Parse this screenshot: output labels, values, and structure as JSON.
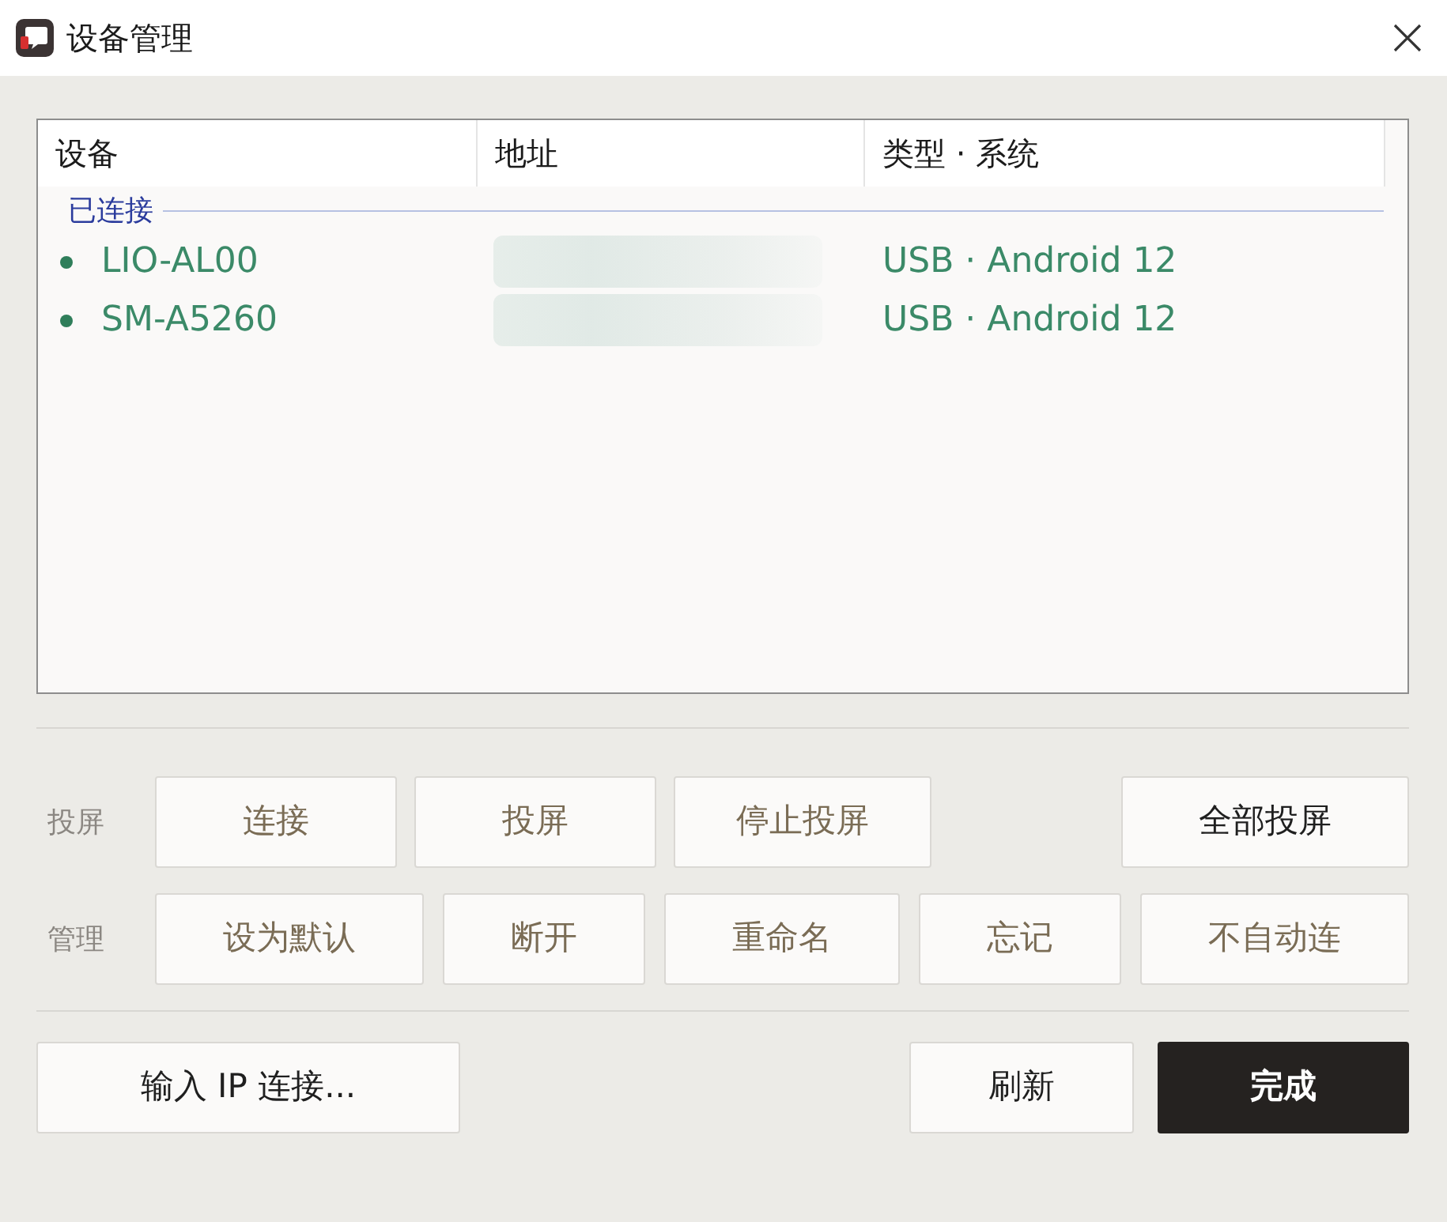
{
  "window": {
    "title": "设备管理"
  },
  "table": {
    "columns": [
      "设备",
      "地址",
      "类型 · 系统"
    ],
    "groups": [
      {
        "label": "已连接",
        "devices": [
          {
            "name": "LIO-AL00",
            "address_blurred": true,
            "type_system": "USB · Android 12"
          },
          {
            "name": "SM-A5260",
            "address_blurred": true,
            "type_system": "USB · Android 12"
          }
        ]
      }
    ]
  },
  "button_rows": [
    {
      "label": "投屏",
      "buttons": [
        {
          "label": "连接",
          "disabled": true
        },
        {
          "label": "投屏",
          "disabled": true
        },
        {
          "label": "停止投屏",
          "disabled": true
        }
      ],
      "trailing_buttons": [
        {
          "label": "全部投屏",
          "disabled": false
        }
      ]
    },
    {
      "label": "管理",
      "buttons": [
        {
          "label": "设为默认",
          "disabled": true
        },
        {
          "label": "断开",
          "disabled": true
        },
        {
          "label": "重命名",
          "disabled": true
        },
        {
          "label": "忘记",
          "disabled": true
        },
        {
          "label": "不自动连",
          "disabled": true
        }
      ]
    }
  ],
  "footer": {
    "left_buttons": [
      {
        "label": "输入 IP 连接...",
        "kind": "plain"
      }
    ],
    "right_buttons": [
      {
        "label": "刷新",
        "kind": "plain"
      },
      {
        "label": "完成",
        "kind": "primary"
      }
    ]
  }
}
